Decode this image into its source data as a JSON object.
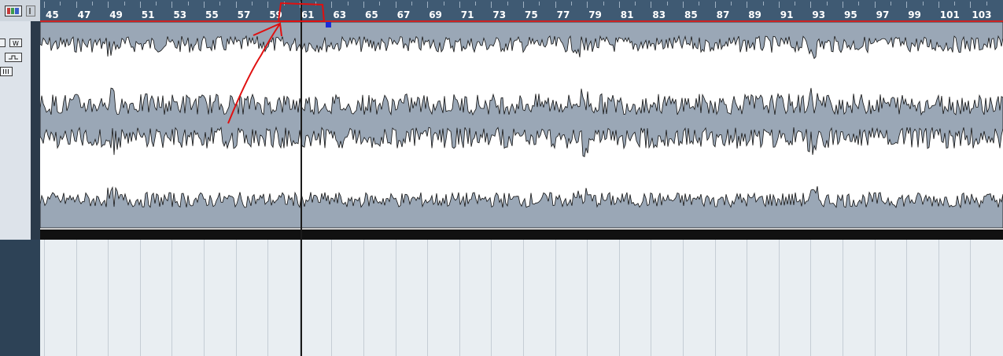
{
  "ruler": {
    "bars": [
      "45",
      "47",
      "49",
      "51",
      "53",
      "55",
      "57",
      "59",
      "61",
      "63",
      "65",
      "67",
      "69",
      "71",
      "73",
      "75",
      "77",
      "79",
      "81",
      "83",
      "85",
      "87",
      "89",
      "91",
      "93",
      "95",
      "97",
      "99",
      "101",
      "103"
    ]
  },
  "toolbar": {
    "w_label": "W"
  },
  "colors": {
    "waveform_fill": "#9aa7b6",
    "ruler_bg": "#3f5a73",
    "annotation": "#e01010",
    "grid_bg": "#e9eef2"
  },
  "icons": {
    "inspector": "color-bars-icon",
    "clip": "waveform-clip-icon",
    "expand": "expand-icon"
  }
}
